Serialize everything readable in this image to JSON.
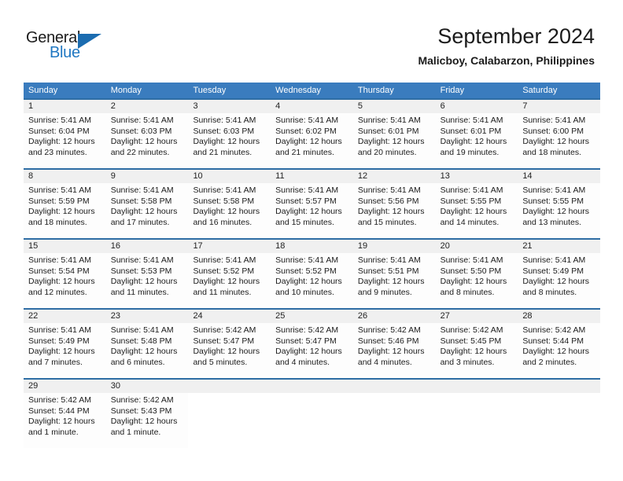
{
  "branding": {
    "name_primary": "General",
    "name_secondary": "Blue"
  },
  "header": {
    "title": "September 2024",
    "location": "Malicboy, Calabarzon, Philippines"
  },
  "colors": {
    "header_blue": "#3a7cbe",
    "row_border_blue": "#2e6da4",
    "date_band_gray": "#f0f0f0",
    "logo_blue": "#1f77c2"
  },
  "weekdays": [
    "Sunday",
    "Monday",
    "Tuesday",
    "Wednesday",
    "Thursday",
    "Friday",
    "Saturday"
  ],
  "weeks": [
    [
      {
        "day": "1",
        "lines": [
          "Sunrise: 5:41 AM",
          "Sunset: 6:04 PM",
          "Daylight: 12 hours",
          "and 23 minutes."
        ]
      },
      {
        "day": "2",
        "lines": [
          "Sunrise: 5:41 AM",
          "Sunset: 6:03 PM",
          "Daylight: 12 hours",
          "and 22 minutes."
        ]
      },
      {
        "day": "3",
        "lines": [
          "Sunrise: 5:41 AM",
          "Sunset: 6:03 PM",
          "Daylight: 12 hours",
          "and 21 minutes."
        ]
      },
      {
        "day": "4",
        "lines": [
          "Sunrise: 5:41 AM",
          "Sunset: 6:02 PM",
          "Daylight: 12 hours",
          "and 21 minutes."
        ]
      },
      {
        "day": "5",
        "lines": [
          "Sunrise: 5:41 AM",
          "Sunset: 6:01 PM",
          "Daylight: 12 hours",
          "and 20 minutes."
        ]
      },
      {
        "day": "6",
        "lines": [
          "Sunrise: 5:41 AM",
          "Sunset: 6:01 PM",
          "Daylight: 12 hours",
          "and 19 minutes."
        ]
      },
      {
        "day": "7",
        "lines": [
          "Sunrise: 5:41 AM",
          "Sunset: 6:00 PM",
          "Daylight: 12 hours",
          "and 18 minutes."
        ]
      }
    ],
    [
      {
        "day": "8",
        "lines": [
          "Sunrise: 5:41 AM",
          "Sunset: 5:59 PM",
          "Daylight: 12 hours",
          "and 18 minutes."
        ]
      },
      {
        "day": "9",
        "lines": [
          "Sunrise: 5:41 AM",
          "Sunset: 5:58 PM",
          "Daylight: 12 hours",
          "and 17 minutes."
        ]
      },
      {
        "day": "10",
        "lines": [
          "Sunrise: 5:41 AM",
          "Sunset: 5:58 PM",
          "Daylight: 12 hours",
          "and 16 minutes."
        ]
      },
      {
        "day": "11",
        "lines": [
          "Sunrise: 5:41 AM",
          "Sunset: 5:57 PM",
          "Daylight: 12 hours",
          "and 15 minutes."
        ]
      },
      {
        "day": "12",
        "lines": [
          "Sunrise: 5:41 AM",
          "Sunset: 5:56 PM",
          "Daylight: 12 hours",
          "and 15 minutes."
        ]
      },
      {
        "day": "13",
        "lines": [
          "Sunrise: 5:41 AM",
          "Sunset: 5:55 PM",
          "Daylight: 12 hours",
          "and 14 minutes."
        ]
      },
      {
        "day": "14",
        "lines": [
          "Sunrise: 5:41 AM",
          "Sunset: 5:55 PM",
          "Daylight: 12 hours",
          "and 13 minutes."
        ]
      }
    ],
    [
      {
        "day": "15",
        "lines": [
          "Sunrise: 5:41 AM",
          "Sunset: 5:54 PM",
          "Daylight: 12 hours",
          "and 12 minutes."
        ]
      },
      {
        "day": "16",
        "lines": [
          "Sunrise: 5:41 AM",
          "Sunset: 5:53 PM",
          "Daylight: 12 hours",
          "and 11 minutes."
        ]
      },
      {
        "day": "17",
        "lines": [
          "Sunrise: 5:41 AM",
          "Sunset: 5:52 PM",
          "Daylight: 12 hours",
          "and 11 minutes."
        ]
      },
      {
        "day": "18",
        "lines": [
          "Sunrise: 5:41 AM",
          "Sunset: 5:52 PM",
          "Daylight: 12 hours",
          "and 10 minutes."
        ]
      },
      {
        "day": "19",
        "lines": [
          "Sunrise: 5:41 AM",
          "Sunset: 5:51 PM",
          "Daylight: 12 hours",
          "and 9 minutes."
        ]
      },
      {
        "day": "20",
        "lines": [
          "Sunrise: 5:41 AM",
          "Sunset: 5:50 PM",
          "Daylight: 12 hours",
          "and 8 minutes."
        ]
      },
      {
        "day": "21",
        "lines": [
          "Sunrise: 5:41 AM",
          "Sunset: 5:49 PM",
          "Daylight: 12 hours",
          "and 8 minutes."
        ]
      }
    ],
    [
      {
        "day": "22",
        "lines": [
          "Sunrise: 5:41 AM",
          "Sunset: 5:49 PM",
          "Daylight: 12 hours",
          "and 7 minutes."
        ]
      },
      {
        "day": "23",
        "lines": [
          "Sunrise: 5:41 AM",
          "Sunset: 5:48 PM",
          "Daylight: 12 hours",
          "and 6 minutes."
        ]
      },
      {
        "day": "24",
        "lines": [
          "Sunrise: 5:42 AM",
          "Sunset: 5:47 PM",
          "Daylight: 12 hours",
          "and 5 minutes."
        ]
      },
      {
        "day": "25",
        "lines": [
          "Sunrise: 5:42 AM",
          "Sunset: 5:47 PM",
          "Daylight: 12 hours",
          "and 4 minutes."
        ]
      },
      {
        "day": "26",
        "lines": [
          "Sunrise: 5:42 AM",
          "Sunset: 5:46 PM",
          "Daylight: 12 hours",
          "and 4 minutes."
        ]
      },
      {
        "day": "27",
        "lines": [
          "Sunrise: 5:42 AM",
          "Sunset: 5:45 PM",
          "Daylight: 12 hours",
          "and 3 minutes."
        ]
      },
      {
        "day": "28",
        "lines": [
          "Sunrise: 5:42 AM",
          "Sunset: 5:44 PM",
          "Daylight: 12 hours",
          "and 2 minutes."
        ]
      }
    ],
    [
      {
        "day": "29",
        "lines": [
          "Sunrise: 5:42 AM",
          "Sunset: 5:44 PM",
          "Daylight: 12 hours",
          "and 1 minute."
        ]
      },
      {
        "day": "30",
        "lines": [
          "Sunrise: 5:42 AM",
          "Sunset: 5:43 PM",
          "Daylight: 12 hours",
          "and 1 minute."
        ]
      },
      {
        "day": "",
        "lines": []
      },
      {
        "day": "",
        "lines": []
      },
      {
        "day": "",
        "lines": []
      },
      {
        "day": "",
        "lines": []
      },
      {
        "day": "",
        "lines": []
      }
    ]
  ]
}
